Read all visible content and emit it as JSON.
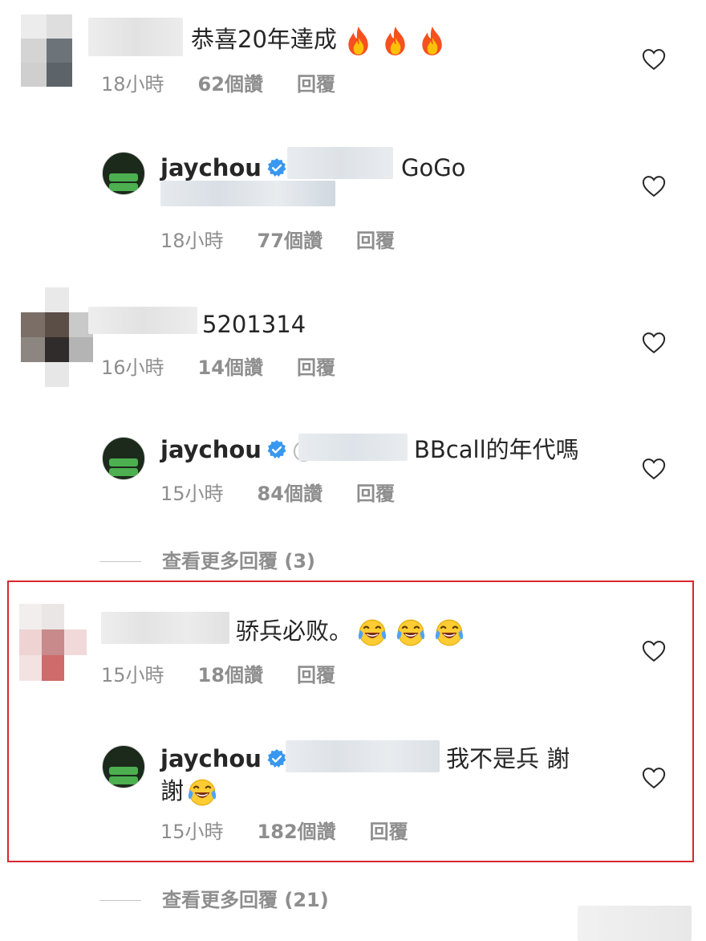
{
  "comments": [
    {
      "text": "恭喜20年達成",
      "emoji": "fire-emoji",
      "time": "18小時",
      "likes": "62個讚",
      "reply": "回覆",
      "reply_comment": {
        "username": "jaychou",
        "text": "GoGo",
        "time": "18小時",
        "likes": "77個讚",
        "reply": "回覆"
      }
    },
    {
      "text": "5201314",
      "time": "16小時",
      "likes": "14個讚",
      "reply": "回覆",
      "reply_comment": {
        "username": "jaychou",
        "prefix": "@",
        "text": "BBcall的年代嗎",
        "time": "15小時",
        "likes": "84個讚",
        "reply": "回覆"
      },
      "view_more": "查看更多回覆 (3)"
    },
    {
      "text": "骄兵必败。",
      "emoji": "tears-of-joy-emoji",
      "time": "15小時",
      "likes": "18個讚",
      "reply": "回覆",
      "reply_comment": {
        "username": "jaychou",
        "text": "我不是兵 謝",
        "text_line2": "謝",
        "time": "15小時",
        "likes": "182個讚",
        "reply": "回覆"
      },
      "view_more": "查看更多回覆 (21)"
    }
  ],
  "colors": {
    "text": "#262626",
    "meta": "#8e8e8e",
    "verified": "#3897f0",
    "highlight": "#d9272e"
  }
}
